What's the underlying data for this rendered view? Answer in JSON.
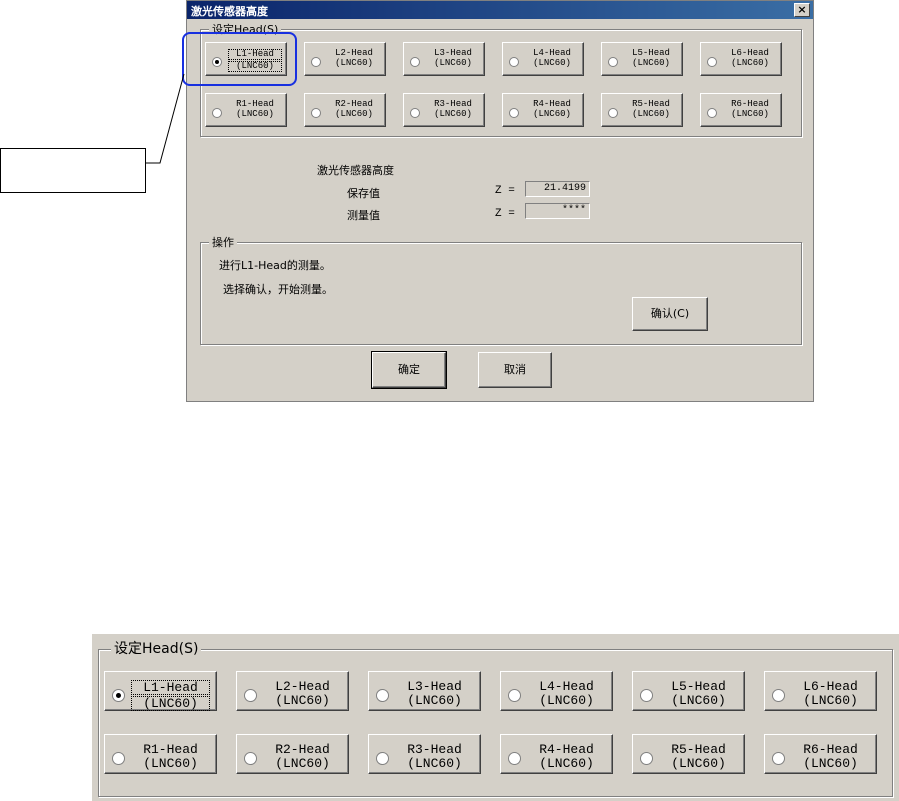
{
  "dialog": {
    "title": "激光传感器高度",
    "close_label": "×",
    "head_group_label": "设定Head(S)",
    "heads_row1": [
      {
        "line1": "L1-Head",
        "line2": "(LNC60)",
        "checked": true
      },
      {
        "line1": "L2-Head",
        "line2": "(LNC60)",
        "checked": false
      },
      {
        "line1": "L3-Head",
        "line2": "(LNC60)",
        "checked": false
      },
      {
        "line1": "L4-Head",
        "line2": "(LNC60)",
        "checked": false
      },
      {
        "line1": "L5-Head",
        "line2": "(LNC60)",
        "checked": false
      },
      {
        "line1": "L6-Head",
        "line2": "(LNC60)",
        "checked": false
      }
    ],
    "heads_row2": [
      {
        "line1": "R1-Head",
        "line2": "(LNC60)",
        "checked": false
      },
      {
        "line1": "R2-Head",
        "line2": "(LNC60)",
        "checked": false
      },
      {
        "line1": "R3-Head",
        "line2": "(LNC60)",
        "checked": false
      },
      {
        "line1": "R4-Head",
        "line2": "(LNC60)",
        "checked": false
      },
      {
        "line1": "R5-Head",
        "line2": "(LNC60)",
        "checked": false
      },
      {
        "line1": "R6-Head",
        "line2": "(LNC60)",
        "checked": false
      }
    ],
    "height_section_title": "激光传感器高度",
    "saved_label": "保存值",
    "saved_z_label": "Z =",
    "saved_value": "21.4199",
    "measured_label": "测量值",
    "measured_z_label": "Z =",
    "measured_value": "****",
    "operation_group_label": "操作",
    "operation_line1": "进行L1-Head的测量。",
    "operation_line2": "选择确认，开始测量。",
    "confirm_button": "确认(C)",
    "ok_button": "确定",
    "cancel_button": "取消"
  },
  "zoom": {
    "group_label": "设定Head(S)"
  },
  "colors": {
    "dialog_face": "#d4d0c8",
    "titlebar": "#0a246a",
    "callout_highlight": "#1830e0"
  }
}
